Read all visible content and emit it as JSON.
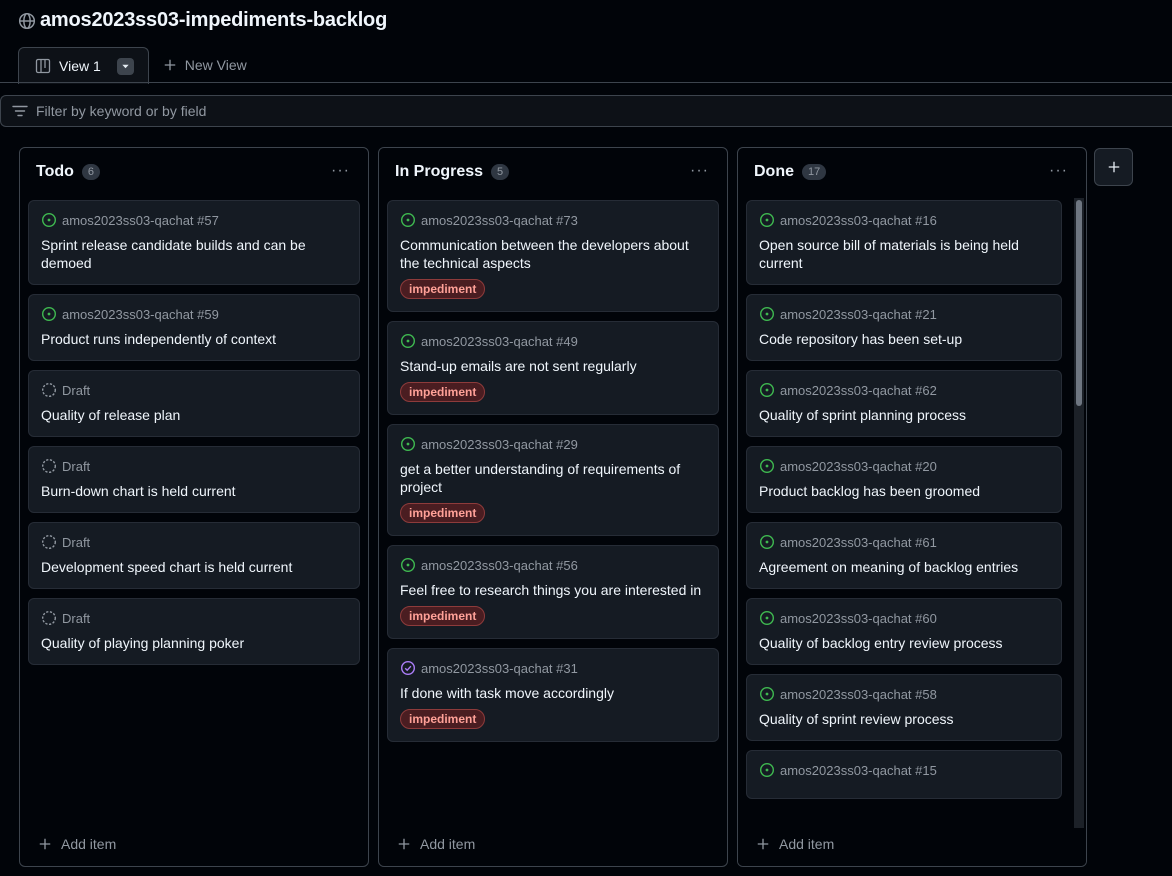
{
  "project": {
    "title": "amos2023ss03-impediments-backlog"
  },
  "tabs": [
    {
      "label": "View 1"
    }
  ],
  "new_view_label": "New View",
  "filter": {
    "placeholder": "Filter by keyword or by field"
  },
  "add_item_label": "Add item",
  "colors": {
    "open_issue": "#3fb950",
    "closed_issue": "#ab7df8",
    "draft": "#9198a1",
    "label_impediment": "#ffa198"
  },
  "columns": [
    {
      "name": "Todo",
      "count": "6",
      "cards": [
        {
          "meta": "amos2023ss03-qachat #57",
          "status": "open",
          "title": "Sprint release candidate builds and can be demoed"
        },
        {
          "meta": "amos2023ss03-qachat #59",
          "status": "open",
          "title": "Product runs independently of context"
        },
        {
          "meta": "Draft",
          "status": "draft",
          "title": "Quality of release plan"
        },
        {
          "meta": "Draft",
          "status": "draft",
          "title": "Burn-down chart is held current"
        },
        {
          "meta": "Draft",
          "status": "draft",
          "title": "Development speed chart is held current"
        },
        {
          "meta": "Draft",
          "status": "draft",
          "title": "Quality of playing planning poker"
        }
      ]
    },
    {
      "name": "In Progress",
      "count": "5",
      "cards": [
        {
          "meta": "amos2023ss03-qachat #73",
          "status": "open",
          "title": "Communication between the developers about the technical aspects",
          "label": "impediment"
        },
        {
          "meta": "amos2023ss03-qachat #49",
          "status": "open",
          "title": "Stand-up emails are not sent regularly",
          "label": "impediment"
        },
        {
          "meta": "amos2023ss03-qachat #29",
          "status": "open",
          "title": "get a better understanding of requirements of project",
          "label": "impediment"
        },
        {
          "meta": "amos2023ss03-qachat #56",
          "status": "open",
          "title": "Feel free to research things you are interested in",
          "label": "impediment"
        },
        {
          "meta": "amos2023ss03-qachat #31",
          "status": "closed",
          "title": "If done with task move accordingly",
          "label": "impediment"
        }
      ]
    },
    {
      "name": "Done",
      "count": "17",
      "cards": [
        {
          "meta": "amos2023ss03-qachat #16",
          "status": "open",
          "title": "Open source bill of materials is being held current"
        },
        {
          "meta": "amos2023ss03-qachat #21",
          "status": "open",
          "title": "Code repository has been set-up"
        },
        {
          "meta": "amos2023ss03-qachat #62",
          "status": "open",
          "title": "Quality of sprint planning process"
        },
        {
          "meta": "amos2023ss03-qachat #20",
          "status": "open",
          "title": "Product backlog has been groomed"
        },
        {
          "meta": "amos2023ss03-qachat #61",
          "status": "open",
          "title": "Agreement on meaning of backlog entries"
        },
        {
          "meta": "amos2023ss03-qachat #60",
          "status": "open",
          "title": "Quality of backlog entry review process"
        },
        {
          "meta": "amos2023ss03-qachat #58",
          "status": "open",
          "title": "Quality of sprint review process"
        },
        {
          "meta": "amos2023ss03-qachat #15",
          "status": "open",
          "title": ""
        }
      ]
    }
  ]
}
